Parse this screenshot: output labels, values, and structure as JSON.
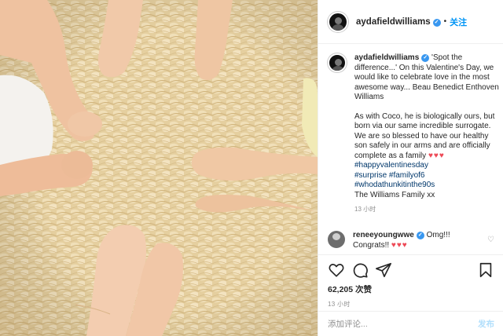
{
  "header": {
    "username": "aydafieldwilliams",
    "verified_mark": "✓",
    "dot": "•",
    "follow_label": "关注"
  },
  "caption": {
    "username": "aydafieldwilliams",
    "line1": "'Spot the difference...' On this Valentine's Day, we would like to celebrate love in the most awesome way... Beau Benedict Enthoven Williams",
    "line2": "As with Coco, he is biologically ours, but born via our same incredible surrogate. We are so blessed to have our healthy son safely in our arms and are officially complete as a family",
    "hearts": "♥♥♥",
    "tags": [
      "#happyvalentinesday",
      "#surprise #familyof6",
      "#whodathunkitinthe90s"
    ],
    "signoff": "The Williams Family xx",
    "time": "13 小时"
  },
  "comment": {
    "username": "reneeyoungwwe",
    "text": "Omg!!! Congrats!!",
    "hearts": "♥♥♥",
    "like_icon": "♡"
  },
  "actions": {
    "icons": [
      "heart-icon",
      "comment-icon",
      "share-icon",
      "bookmark-icon"
    ],
    "likes": "62,205 次赞",
    "post_time": "13 小时"
  },
  "add_comment": {
    "placeholder": "添加评论...",
    "post_label": "发布"
  },
  "colors": {
    "accent": "#0095f6",
    "verified": "#3897f0",
    "heart": "#ed4956",
    "rug": "#e7d3a8"
  }
}
